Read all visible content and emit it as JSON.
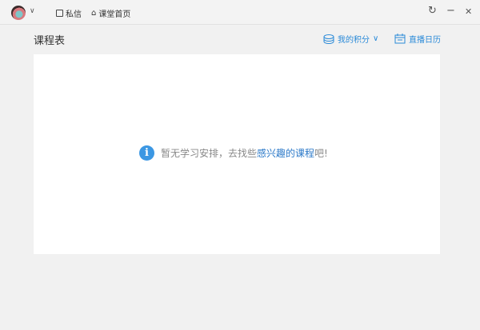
{
  "titlebar": {
    "messages": "私信",
    "classroom_home": "课堂首页",
    "refresh_icon": "↻",
    "minimize_icon": "−",
    "close_icon": "✕"
  },
  "page": {
    "title": "课程表"
  },
  "toolbar": {
    "points": "我的积分",
    "live_calendar": "直播日历"
  },
  "empty": {
    "prefix": "暂无学习安排，去找些",
    "link": "感兴趣的课程",
    "suffix": "吧!"
  },
  "colors": {
    "accent": "#2a8ad8",
    "info": "#3b97e3"
  }
}
